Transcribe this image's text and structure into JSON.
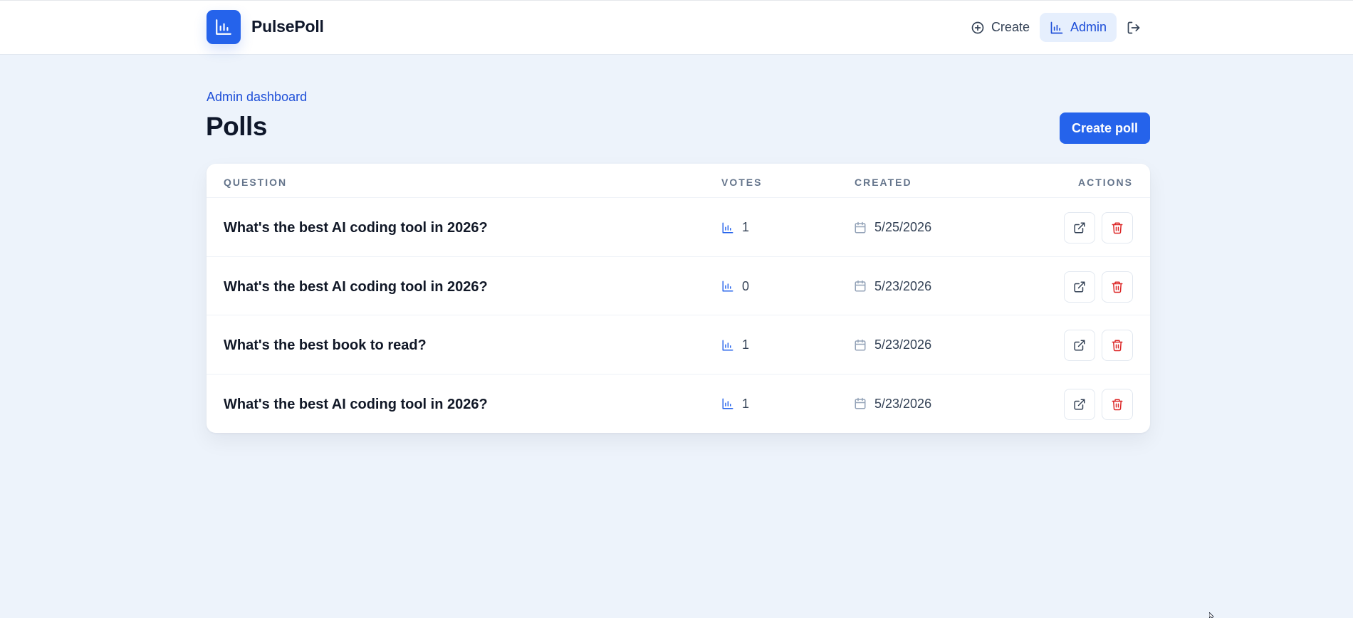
{
  "app": {
    "name": "PulsePoll",
    "logo_icon": "bar-chart-icon"
  },
  "nav": {
    "create_label": "Create",
    "admin_label": "Admin",
    "logout_icon": "logout-icon"
  },
  "page": {
    "eyebrow": "Admin dashboard",
    "title": "Polls",
    "create_button": "Create poll"
  },
  "table": {
    "headers": {
      "question": "QUESTION",
      "votes": "VOTES",
      "created": "CREATED",
      "actions": "ACTIONS"
    },
    "rows": [
      {
        "question": "What's the best AI coding tool in 2026?",
        "votes": "1",
        "created": "5/25/2026"
      },
      {
        "question": "What's the best AI coding tool in 2026?",
        "votes": "0",
        "created": "5/23/2026"
      },
      {
        "question": "What's the best book to read?",
        "votes": "1",
        "created": "5/23/2026"
      },
      {
        "question": "What's the best AI coding tool in 2026?",
        "votes": "1",
        "created": "5/23/2026"
      }
    ]
  },
  "colors": {
    "accent": "#2563eb",
    "background": "#edf3fb",
    "danger": "#dc2626"
  }
}
